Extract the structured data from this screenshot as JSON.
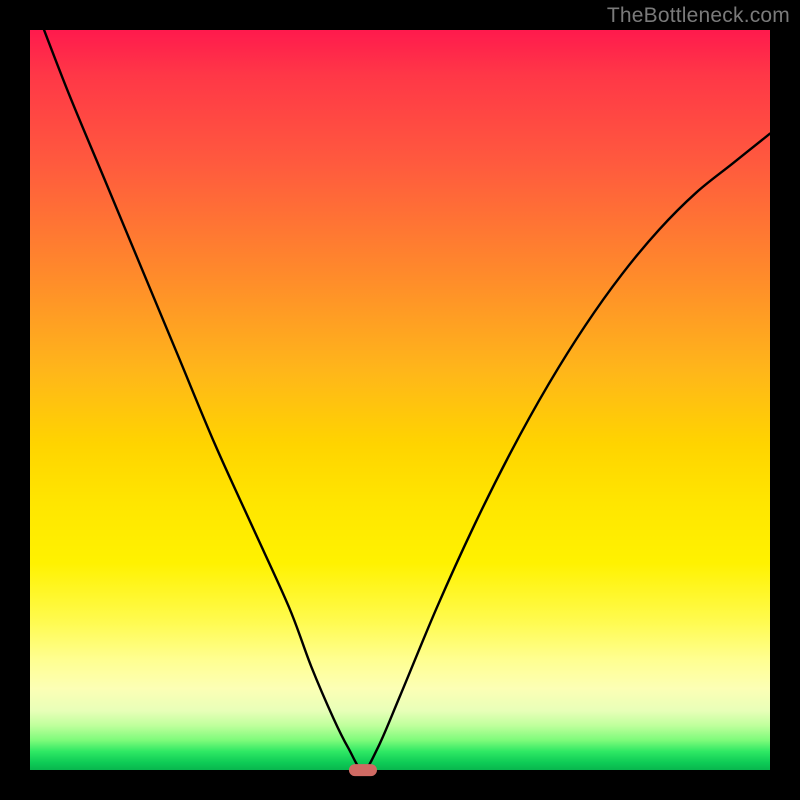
{
  "watermark": "TheBottleneck.com",
  "chart_data": {
    "type": "line",
    "title": "",
    "xlabel": "",
    "ylabel": "",
    "xlim": [
      0,
      1
    ],
    "ylim": [
      0,
      1
    ],
    "grid": false,
    "legend": false,
    "background_gradient": {
      "direction": "top-to-bottom",
      "stops": [
        {
          "pos": 0.0,
          "color": "#ff1a4d"
        },
        {
          "pos": 0.5,
          "color": "#ffcc00"
        },
        {
          "pos": 0.8,
          "color": "#ffff66"
        },
        {
          "pos": 0.95,
          "color": "#99ff66"
        },
        {
          "pos": 1.0,
          "color": "#08b64d"
        }
      ]
    },
    "series": [
      {
        "name": "bottleneck-curve",
        "color": "#000000",
        "x": [
          0.0,
          0.05,
          0.1,
          0.15,
          0.2,
          0.25,
          0.3,
          0.35,
          0.38,
          0.41,
          0.43,
          0.45,
          0.47,
          0.5,
          0.55,
          0.6,
          0.65,
          0.7,
          0.75,
          0.8,
          0.85,
          0.9,
          0.95,
          1.0
        ],
        "y": [
          1.05,
          0.92,
          0.8,
          0.68,
          0.56,
          0.44,
          0.33,
          0.22,
          0.14,
          0.07,
          0.03,
          0.0,
          0.03,
          0.1,
          0.22,
          0.33,
          0.43,
          0.52,
          0.6,
          0.67,
          0.73,
          0.78,
          0.82,
          0.86
        ]
      }
    ],
    "marker": {
      "name": "optimal-point",
      "shape": "rounded-rect",
      "color": "#cf6a63",
      "x": 0.45,
      "y": 0.0,
      "width_frac": 0.038,
      "height_frac": 0.016
    }
  }
}
